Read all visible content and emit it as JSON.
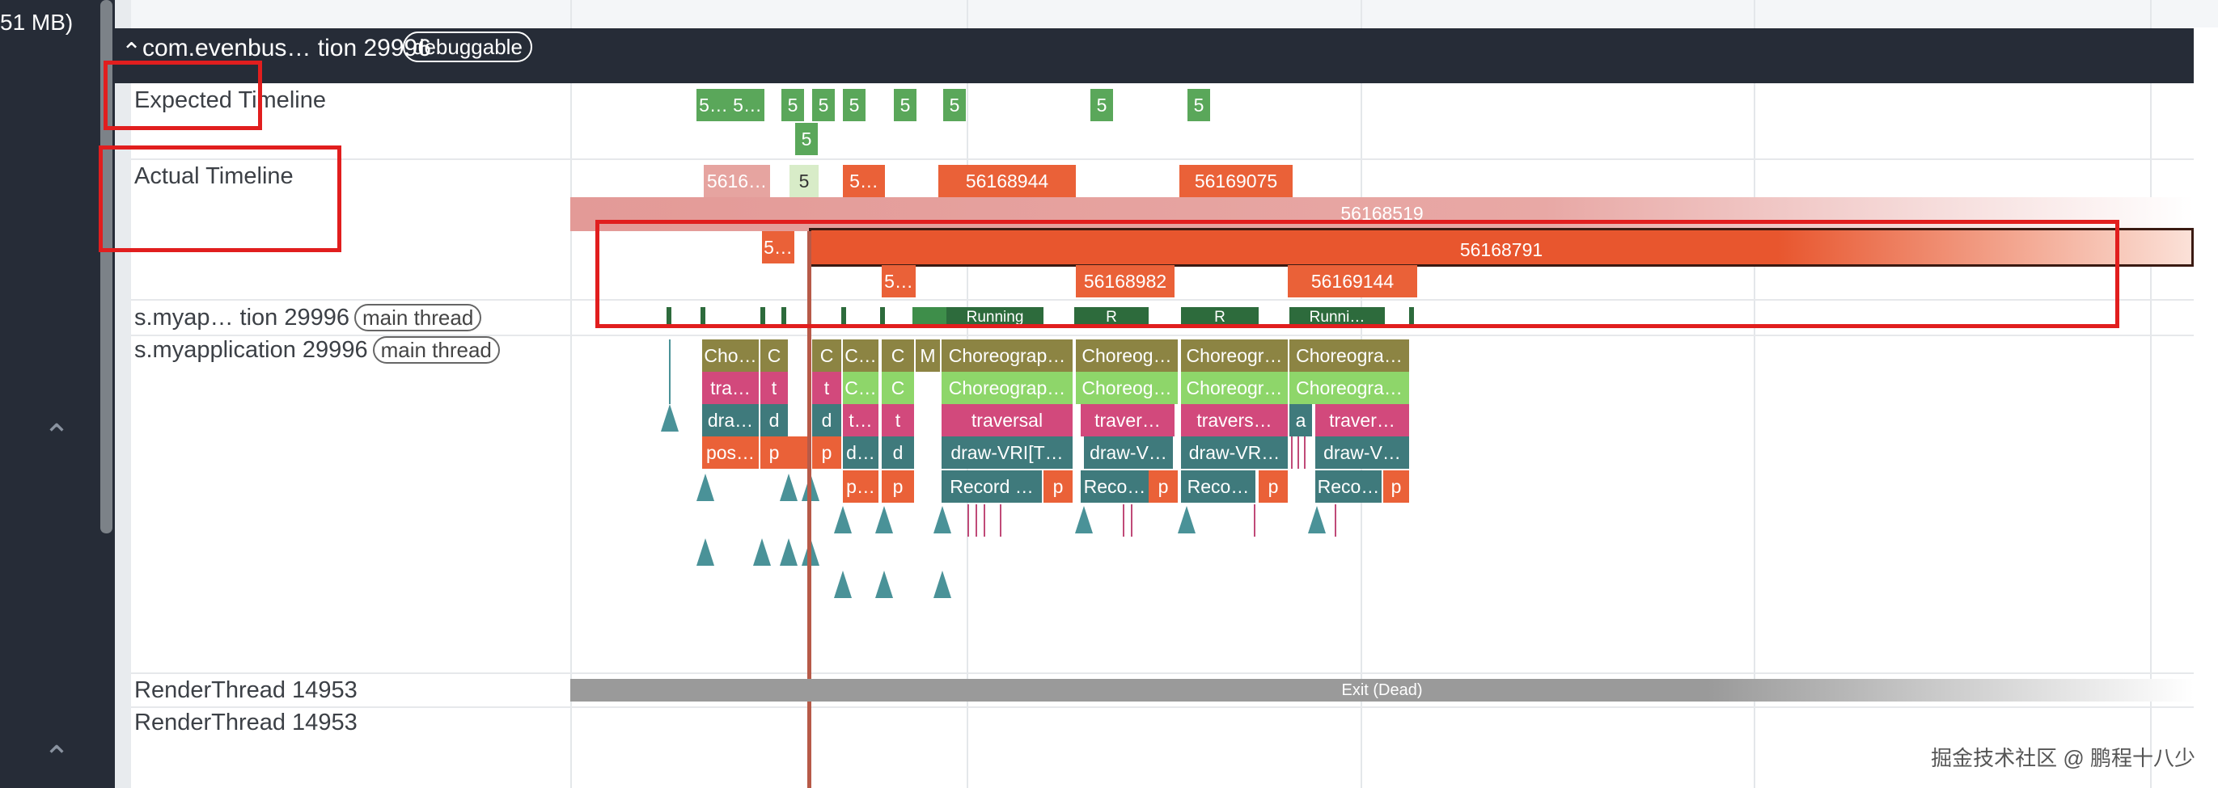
{
  "left_panel": {
    "size_label": "51 MB)"
  },
  "process": {
    "title": "com.evenbus… tion 29996",
    "badge": "debuggable"
  },
  "rows": {
    "expected": "Expected Timeline",
    "actual": "Actual Timeline",
    "main_thread_1": {
      "name": "s.myap… tion 29996",
      "tag": "main thread"
    },
    "main_thread_2": {
      "name": "s.myapplication 29996",
      "tag": "main thread"
    },
    "render_1": "RenderThread 14953",
    "render_2": "RenderThread 14953"
  },
  "expected_slices": [
    "5…",
    "5…",
    "5",
    "5",
    "5",
    "5",
    "5",
    "5",
    "5",
    "5"
  ],
  "actual_slices": [
    "5616…",
    "5",
    "5…",
    "56168944",
    "56169075",
    "56168519",
    "5…",
    "56168791",
    "5…",
    "56168982",
    "56169144"
  ],
  "state_slices": [
    "Running",
    "R",
    "R",
    "Runni…"
  ],
  "flame_row1": [
    "Cho…",
    "C",
    "C",
    "C…",
    "C",
    "M",
    "Choreograp…",
    "Choreog…",
    "Choreogr…",
    "Choreogra…"
  ],
  "flame_row2": [
    "tra…",
    "t",
    "t",
    "C…",
    "C",
    "Choreograp…",
    "Choreog…",
    "Choreogr…",
    "Choreogra…"
  ],
  "flame_row3": [
    "dra…",
    "d",
    "d",
    "t…",
    "t",
    "traversal",
    "traver…",
    "travers…",
    "a",
    "traver…"
  ],
  "flame_row4": [
    "pos…",
    "p",
    "p",
    "d…",
    "d",
    "draw-VRI[T…",
    "draw-V…",
    "draw-VR…",
    "draw-V…"
  ],
  "flame_row5": [
    "p…",
    "p",
    "Record …",
    "p",
    "Reco…",
    "p",
    "Reco…",
    "p",
    "Reco…",
    "p"
  ],
  "render_state": "Exit (Dead)",
  "watermark": "掘金技术社区 @ 鹏程十八少",
  "colors": {
    "dark_bg": "#262c37",
    "green": "#5aa75a",
    "orange": "#ea6138",
    "pink": "#d2497c",
    "olive": "#8c8443",
    "teal": "#3f7a7c",
    "highlight_red": "#e11e1e"
  }
}
